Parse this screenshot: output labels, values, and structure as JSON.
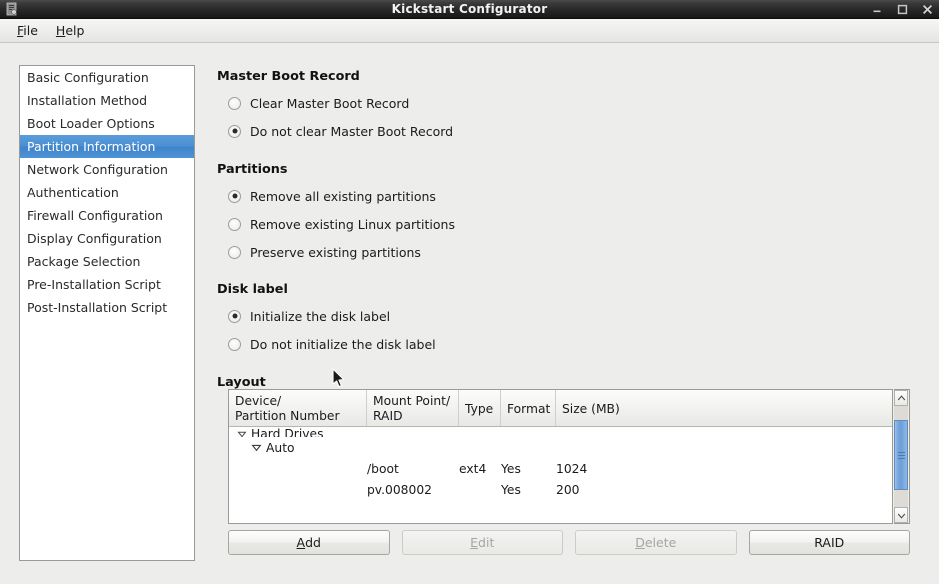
{
  "window": {
    "title": "Kickstart Configurator",
    "app_icon": "app-icon",
    "controls": {
      "minimize": "–",
      "maximize": "□",
      "close": "✕"
    }
  },
  "menubar": {
    "items": [
      {
        "label": "File",
        "accel": "F"
      },
      {
        "label": "Help",
        "accel": "H"
      }
    ]
  },
  "sidebar": {
    "items": [
      {
        "label": "Basic Configuration",
        "selected": false
      },
      {
        "label": "Installation Method",
        "selected": false
      },
      {
        "label": "Boot Loader Options",
        "selected": false
      },
      {
        "label": "Partition Information",
        "selected": true
      },
      {
        "label": "Network Configuration",
        "selected": false
      },
      {
        "label": "Authentication",
        "selected": false
      },
      {
        "label": "Firewall Configuration",
        "selected": false
      },
      {
        "label": "Display Configuration",
        "selected": false
      },
      {
        "label": "Package Selection",
        "selected": false
      },
      {
        "label": "Pre-Installation Script",
        "selected": false
      },
      {
        "label": "Post-Installation Script",
        "selected": false
      }
    ]
  },
  "main": {
    "mbr": {
      "title": "Master Boot Record",
      "options": [
        {
          "label": "Clear Master Boot Record",
          "checked": false
        },
        {
          "label": "Do not clear Master Boot Record",
          "checked": true
        }
      ]
    },
    "partitions": {
      "title": "Partitions",
      "options": [
        {
          "label": "Remove all existing partitions",
          "checked": true
        },
        {
          "label": "Remove existing Linux partitions",
          "checked": false
        },
        {
          "label": "Preserve existing partitions",
          "checked": false
        }
      ]
    },
    "disk_label": {
      "title": "Disk label",
      "options": [
        {
          "label": "Initialize the disk label",
          "checked": true
        },
        {
          "label": "Do not initialize the disk label",
          "checked": false
        }
      ]
    },
    "layout": {
      "title": "Layout",
      "columns": [
        "Device/\nPartition Number",
        "Mount Point/\nRAID",
        "Type",
        "Format",
        "Size (MB)"
      ],
      "rows": [
        {
          "device": "Hard Drives",
          "mount": "",
          "type": "",
          "format": "",
          "size": "",
          "indent": 1,
          "expander": "expanded",
          "clipped": true
        },
        {
          "device": "Auto",
          "mount": "",
          "type": "",
          "format": "",
          "size": "",
          "indent": 2,
          "expander": "expanded",
          "clipped": false
        },
        {
          "device": "",
          "mount": "/boot",
          "type": "ext4",
          "format": "Yes",
          "size": "1024",
          "indent": 3,
          "expander": "none",
          "clipped": false
        },
        {
          "device": "",
          "mount": "pv.008002",
          "type": "",
          "format": "Yes",
          "size": "200",
          "indent": 3,
          "expander": "none",
          "clipped": false
        }
      ],
      "scrollbar": {
        "up": "▲",
        "down": "▼"
      }
    },
    "buttons": [
      {
        "label": "Add",
        "accel": "A",
        "enabled": true
      },
      {
        "label": "Edit",
        "accel": "E",
        "enabled": false
      },
      {
        "label": "Delete",
        "accel": "D",
        "enabled": false
      },
      {
        "label": "RAID",
        "accel": "",
        "enabled": true
      }
    ]
  },
  "colors": {
    "selection_blue": "#4a8fd2",
    "window_bg": "#ededeb",
    "titlebar_dark": "#272727",
    "scrollbar_thumb": "#79a8dd"
  }
}
